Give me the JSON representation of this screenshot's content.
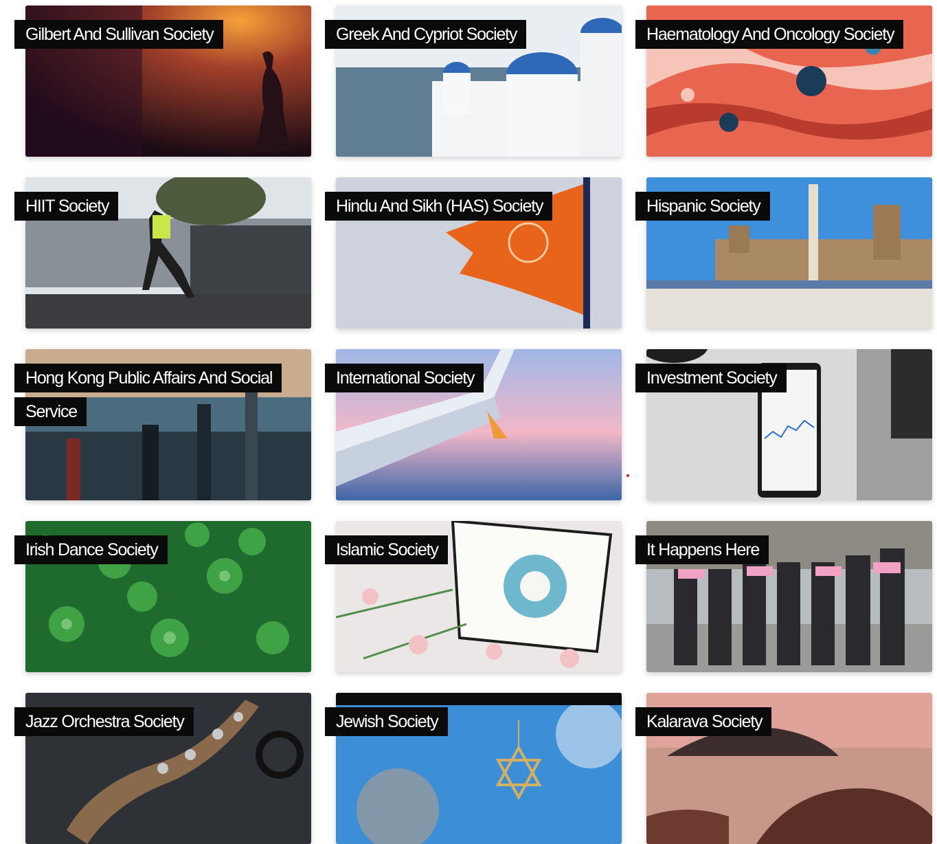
{
  "societies": [
    {
      "name": "Gilbert And Sullivan Society",
      "image_icon": "theatre-stage-dancer"
    },
    {
      "name": "Greek And Cypriot Society",
      "image_icon": "santorini-domes"
    },
    {
      "name": "Haematology And Oncology Society",
      "image_icon": "fluid-art-red-cells"
    },
    {
      "name": "HIIT Society",
      "image_icon": "woman-running"
    },
    {
      "name": "Hindu And Sikh (HAS) Society",
      "image_icon": "orange-om-flag"
    },
    {
      "name": "Hispanic Society",
      "image_icon": "plaza-de-espana"
    },
    {
      "name": "Hong Kong Public Affairs And Social Service",
      "image_icon": "hong-kong-skyline"
    },
    {
      "name": "International Society",
      "image_icon": "airplane-wing-sky"
    },
    {
      "name": "Investment Society",
      "image_icon": "phone-stock-chart"
    },
    {
      "name": "Irish Dance Society",
      "image_icon": "shamrock-clovers"
    },
    {
      "name": "Islamic Society",
      "image_icon": "quran-flowers"
    },
    {
      "name": "It Happens Here",
      "image_icon": "women-holding-signs"
    },
    {
      "name": "Jazz Orchestra Society",
      "image_icon": "saxophone"
    },
    {
      "name": "Jewish Society",
      "image_icon": "star-of-david-pendant"
    },
    {
      "name": "Kalarava Society",
      "image_icon": "rocky-coast-sunset"
    }
  ]
}
